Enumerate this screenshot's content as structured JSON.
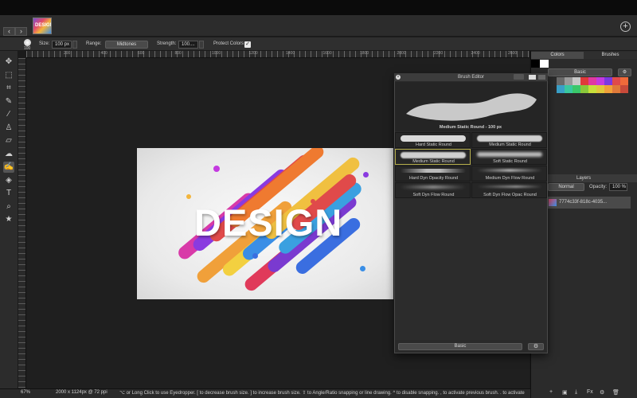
{
  "toolbar_options": {
    "brush_size_readout": "100",
    "size_label": "Size:",
    "size_value": "100 px",
    "range_label": "Range:",
    "range_value": "Midtones",
    "strength_label": "Strength:",
    "strength_value": "100....",
    "protect_label": "Protect Colors",
    "protect_checked": "✓"
  },
  "ruler_ticks": [
    "200",
    "400",
    "600",
    "800",
    "1000",
    "1200",
    "1400",
    "1600",
    "1800",
    "2000",
    "2200",
    "2400",
    "2600"
  ],
  "tools": [
    "move-icon",
    "marquee-icon",
    "crop-icon",
    "eyedropper-icon",
    "brush-icon",
    "stamp-icon",
    "eraser-icon",
    "smudge-icon",
    "paint-brush-icon",
    "fill-icon",
    "text-icon",
    "zoom-icon",
    "star-icon"
  ],
  "tool_glyphs": [
    "✥",
    "⬚",
    "⌗",
    "✎",
    "⁄",
    "♙",
    "▱",
    "☁",
    "✍",
    "◈",
    "T",
    "⌕",
    "★"
  ],
  "canvas": {
    "artwork_text": "DESIGN"
  },
  "status": {
    "zoom": "67%",
    "dimensions": "2000 x 1124px @ 72 ppi",
    "hint": "⌥ or Long Click to use Eyedropper. [ to decrease brush size. ] to increase brush size. ⇧ to Angle/Ratio snapping or line drawing. ^ to disable snapping. , to activate previous brush. . to activate"
  },
  "right_panel": {
    "tab_colors": "Colors",
    "tab_brushes": "Brushes",
    "palette_select": "Basic",
    "swatches": [
      "#6a6a6a",
      "#9a9a9a",
      "#c8c8c8",
      "#e03a3a",
      "#e03aa0",
      "#c43ae0",
      "#7a3ae0",
      "#e04a4a",
      "#f06a3a",
      "#3aa0c8",
      "#3ac8a0",
      "#3ac86a",
      "#8ac83a",
      "#c8e03a",
      "#e0c83a",
      "#f0a03a",
      "#e07a3a",
      "#c84a3a"
    ],
    "layers_title": "Layers",
    "blend_mode": "Normal",
    "opacity_label": "Opacity:",
    "opacity_value": "100 %",
    "layer_name": "7774c33f-818c-4035..."
  },
  "brush_editor": {
    "title": "Brush Editor",
    "preview_name": "Medium Static Round - 100 px",
    "brushes": [
      "Hard Static Round",
      "Medium Static Round",
      "Medium Static Round",
      "Soft Static Round",
      "Hard Dyn Opacity Round",
      "Medium Dyn Flow Round",
      "Soft Dyn Flow Round",
      "Soft Dyn Flow Opac Round"
    ],
    "footer_select": "Basic"
  }
}
